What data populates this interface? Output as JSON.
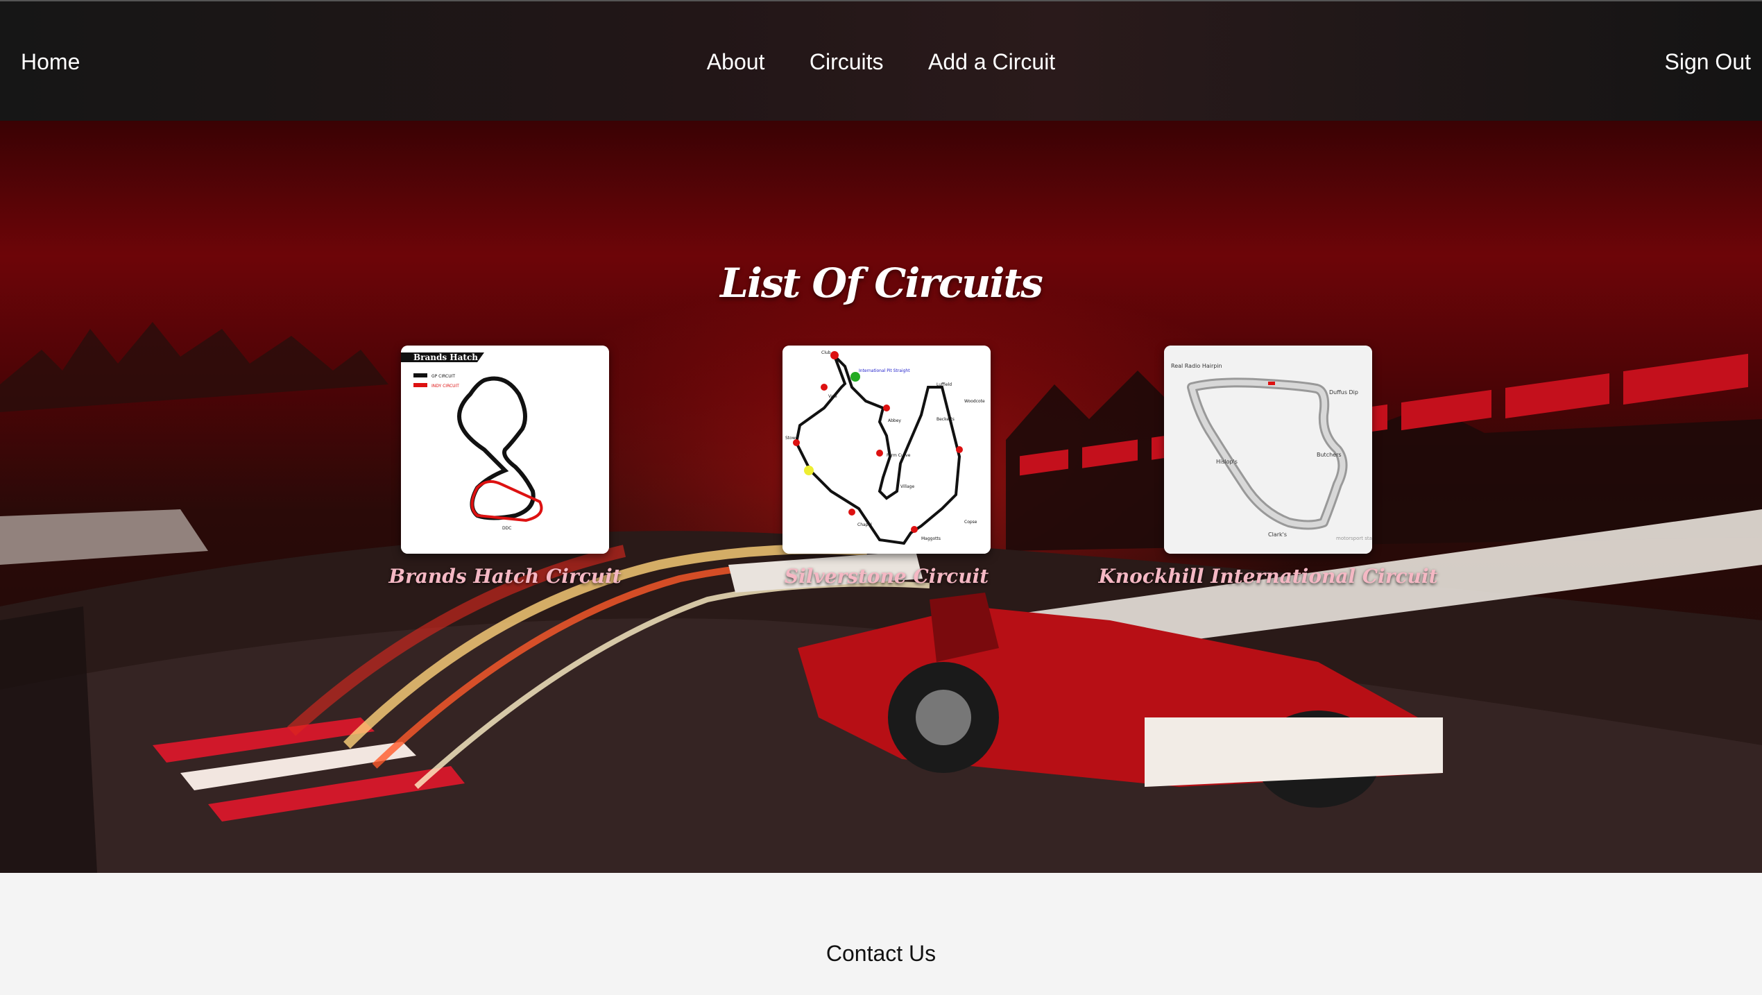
{
  "nav": {
    "home": "Home",
    "about": "About",
    "circuits": "Circuits",
    "add_circuit": "Add a Circuit",
    "sign_out": "Sign Out"
  },
  "main": {
    "title": "List Of Circuits",
    "circuits": [
      {
        "name": "Brands Hatch Circuit",
        "map_header": "Brands Hatch",
        "legend": [
          "GP CIRCUIT",
          "INDY CIRCUIT"
        ]
      },
      {
        "name": "Silverstone Circuit",
        "map_labels": [
          "Club",
          "Abbey",
          "Farm Curve",
          "Village",
          "Luffield",
          "Woodcote",
          "Copse",
          "Maggotts",
          "Becketts",
          "Chapel",
          "Stowe",
          "Vale"
        ]
      },
      {
        "name": "Knockhill International Circuit",
        "map_labels": [
          "Real Radio Hairpin",
          "Butchers",
          "Clark's",
          "Hislop's",
          "Duffus Dip",
          "motorsport stats"
        ]
      }
    ]
  },
  "footer": {
    "contact": "Contact Us"
  },
  "colors": {
    "nav_bg": "#161616",
    "hero_red": "#8b0a0d",
    "caption_pink": "#f5b8c4",
    "footer_bg": "#f4f4f4"
  }
}
